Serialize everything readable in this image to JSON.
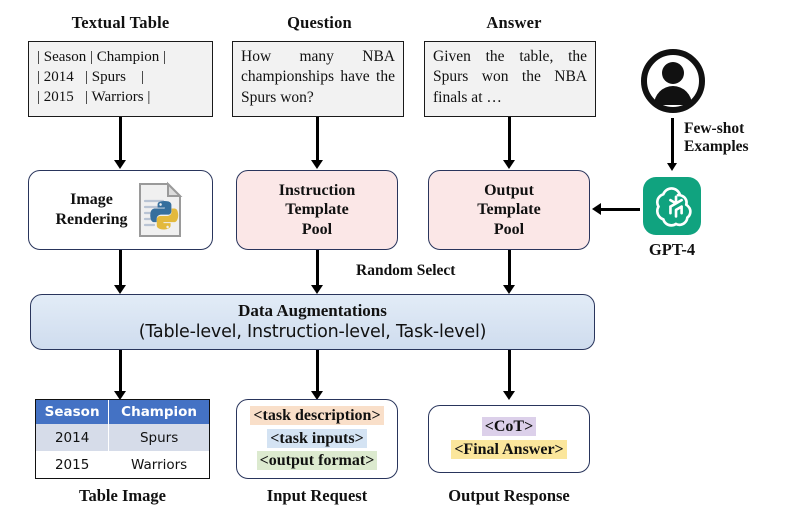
{
  "figure": {
    "type": "pipeline-diagram",
    "title_row": {
      "textual_table": "Textual Table",
      "question": "Question",
      "answer": "Answer"
    },
    "sources": {
      "textual_table": {
        "lines": [
          "| Season | Champion |",
          "| 2014   | Spurs    |",
          "| 2015   | Warriors |"
        ]
      },
      "question": {
        "text": "How many NBA championships have the Spurs won?"
      },
      "answer": {
        "text": "Given the table, the Spurs won the NBA finals at …"
      }
    },
    "process": {
      "image_rendering": "Image\nRendering",
      "image_rendering_line1": "Image",
      "image_rendering_line2": "Rendering",
      "instruction_pool_line1": "Instruction",
      "instruction_pool_line2": "Template",
      "instruction_pool_line3": "Pool",
      "output_pool_line1": "Output",
      "output_pool_line2": "Template",
      "output_pool_line3": "Pool",
      "random_select": "Random Select"
    },
    "llm": {
      "few_shot_line1": "Few-shot",
      "few_shot_line2": "Examples",
      "model_name": "GPT-4"
    },
    "augmentation": {
      "line1": "Data Augmentations",
      "line2": "(Table-level, Instruction-level, Task-level)"
    },
    "outputs": {
      "table_image": {
        "caption": "Table Image",
        "headers": [
          "Season",
          "Champion"
        ],
        "rows": [
          [
            "2014",
            "Spurs"
          ],
          [
            "2015",
            "Warriors"
          ]
        ]
      },
      "input_request": {
        "caption": "Input Request",
        "tokens": [
          {
            "text": "<task description>",
            "color": "#f9dfc9"
          },
          {
            "text": "<task inputs>",
            "color": "#d4e3f3"
          },
          {
            "text": "<output format>",
            "color": "#dceacf"
          }
        ]
      },
      "output_response": {
        "caption": "Output Response",
        "tokens": [
          {
            "text": "<CoT>",
            "color": "#dcd0ea"
          },
          {
            "text": "<Final Answer>",
            "color": "#fbe69c"
          }
        ]
      }
    },
    "colors": {
      "box_border": "#29355c",
      "pink_fill": "#fbe7e7",
      "blue_fill": "#cfdcee",
      "table_header": "#4472c4",
      "table_alt_row": "#d6dce9",
      "gpt_green": "#10a37f",
      "arrow": "#000000"
    }
  }
}
